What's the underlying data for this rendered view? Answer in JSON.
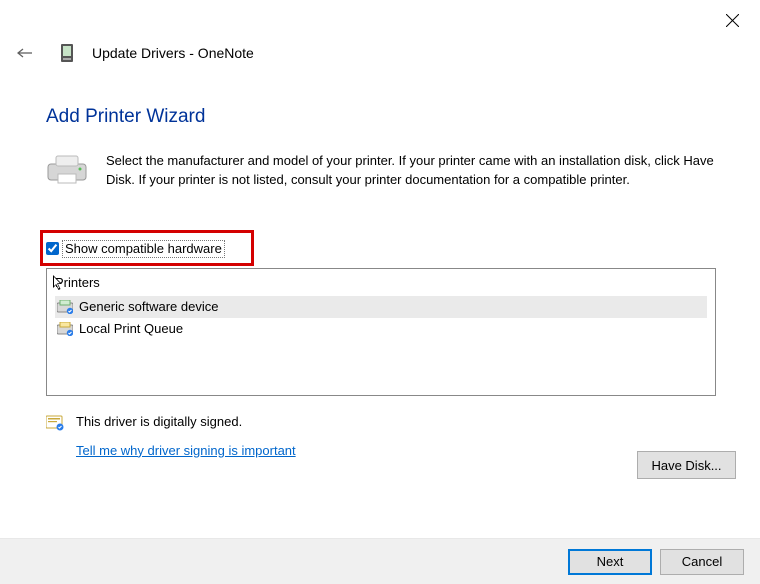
{
  "window": {
    "title": "Update Drivers - OneNote"
  },
  "wizard": {
    "heading": "Add Printer Wizard",
    "intro": "Select the manufacturer and model of your printer. If your printer came with an installation disk, click Have Disk. If your printer is not listed, consult your printer documentation for a compatible printer.",
    "compat_label": "Show compatible hardware",
    "list_heading": "Printers",
    "items": [
      {
        "label": "Generic software device",
        "selected": true
      },
      {
        "label": "Local Print Queue",
        "selected": false
      }
    ],
    "signed_text": "This driver is digitally signed.",
    "signing_link": "Tell me why driver signing is important",
    "have_disk": "Have Disk..."
  },
  "footer": {
    "next": "Next",
    "cancel": "Cancel"
  }
}
